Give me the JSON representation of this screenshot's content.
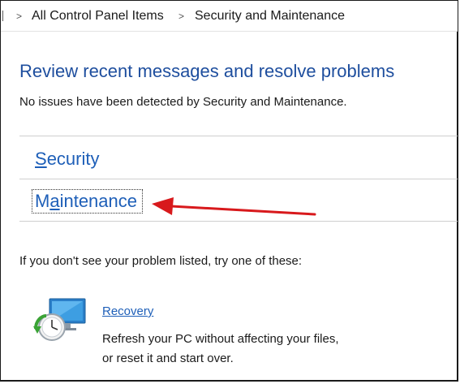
{
  "breadcrumb": {
    "items": [
      "All Control Panel Items",
      "Security and Maintenance"
    ],
    "separator": ">"
  },
  "main": {
    "heading": "Review recent messages and resolve problems",
    "status": "No issues have been detected by Security and Maintenance.",
    "sections": [
      {
        "access_key": "S",
        "rest": "ecurity"
      },
      {
        "prefix": "M",
        "access_key": "a",
        "rest": "intenance"
      }
    ],
    "try_prompt": "If you don't see your problem listed, try one of these:"
  },
  "recovery": {
    "title": "Recovery",
    "description": "Refresh your PC without affecting your files, or reset it and start over.",
    "icon": "recovery-icon"
  },
  "annotation": {
    "arrow_color": "#d8191c"
  },
  "colors": {
    "heading": "#1e4e9e",
    "link": "#1e5fb8"
  }
}
